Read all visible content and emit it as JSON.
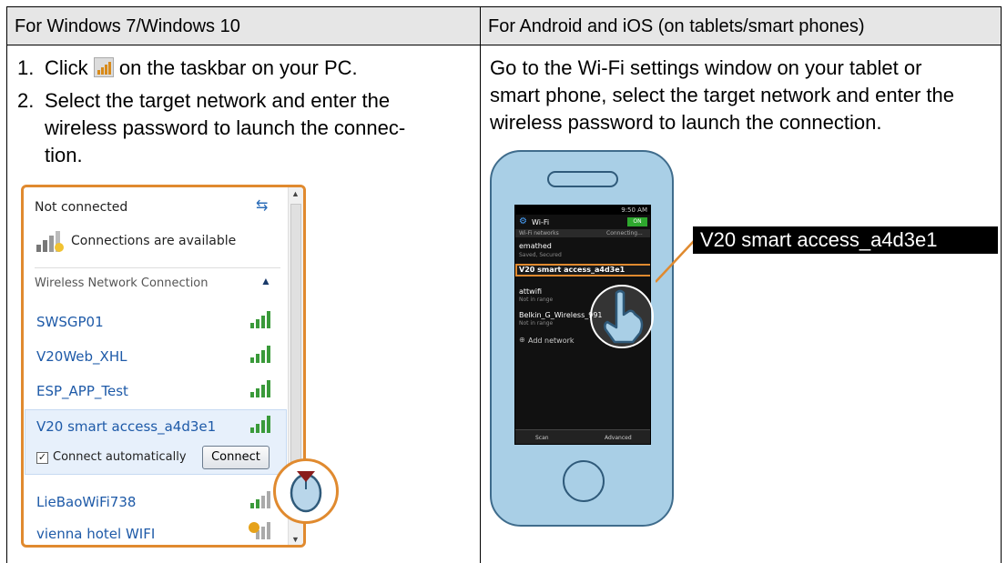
{
  "header": {
    "left": "For Windows 7/Windows 10",
    "right": "For Android and iOS (on tablets/smart phones)"
  },
  "left_steps": [
    {
      "num": "1.",
      "text_before_icon": "Click",
      "text_after_icon": "on the taskbar on your PC."
    },
    {
      "num": "2.",
      "lines": [
        "Select the target network and enter the",
        "wireless password to launch the connec-",
        "tion."
      ]
    }
  ],
  "right_text": [
    "Go to the Wi-Fi settings window on your tablet or",
    "smart phone, select the target network and enter the",
    "wireless password to launch the connection."
  ],
  "windows_flyout": {
    "status": "Not connected",
    "available": "Connections are available",
    "section": "Wireless Network Connection",
    "networks": [
      "SWSGP01",
      "V20Web_XHL",
      "ESP_APP_Test",
      "V20 smart access_a4d3e1",
      "LieBaoWiFi738",
      "vienna hotel WIFI"
    ],
    "connect_auto": "Connect automatically",
    "connect_button": "Connect"
  },
  "phone_screen": {
    "time": "9:50 AM",
    "title": "Wi-Fi",
    "toggle": "ON",
    "networks_label": "Wi-Fi networks",
    "connecting": "Connecting...",
    "items": [
      {
        "name": "emathed",
        "sub": "Saved, Secured"
      },
      {
        "name": "V20 smart access_a4d3e1",
        "sub": ""
      },
      {
        "name": "attwifi",
        "sub": "Not in range"
      },
      {
        "name": "Belkin_G_Wireless_991",
        "sub": "Not in range"
      }
    ],
    "add_network": "Add network",
    "scan": "Scan",
    "advanced": "Advanced"
  },
  "callout": "V20 smart access_a4d3e1",
  "colors": {
    "accent_orange": "#e08a2f",
    "link_blue": "#1e5aa8",
    "header_gray": "#e6e6e6",
    "phone_body": "#a9cfe6"
  }
}
